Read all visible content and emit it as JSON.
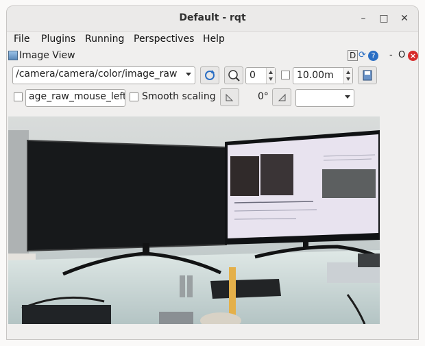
{
  "window": {
    "title": "Default - rqt",
    "minimize": "–",
    "maximize": "□",
    "close": "✕"
  },
  "menu": [
    {
      "label": "File"
    },
    {
      "label": "Plugins"
    },
    {
      "label": "Running"
    },
    {
      "label": "Perspectives"
    },
    {
      "label": "Help"
    }
  ],
  "dock": {
    "title": "Image View",
    "d_label": "D",
    "minus": "-",
    "o_label": "O",
    "close": "×"
  },
  "toolbar": {
    "topic": "/camera/camera/color/image_raw",
    "spin_value": "0",
    "distance_value": "10.00m",
    "mouse_topic": "age_raw_mouse_left",
    "smooth_label": "Smooth scaling",
    "rotation": "0°",
    "extra_combo": ""
  },
  "image": {
    "description_colors": {
      "monitor": "#17191b",
      "screen": "#e8e3ef",
      "desk": "#c9d6d6"
    }
  }
}
